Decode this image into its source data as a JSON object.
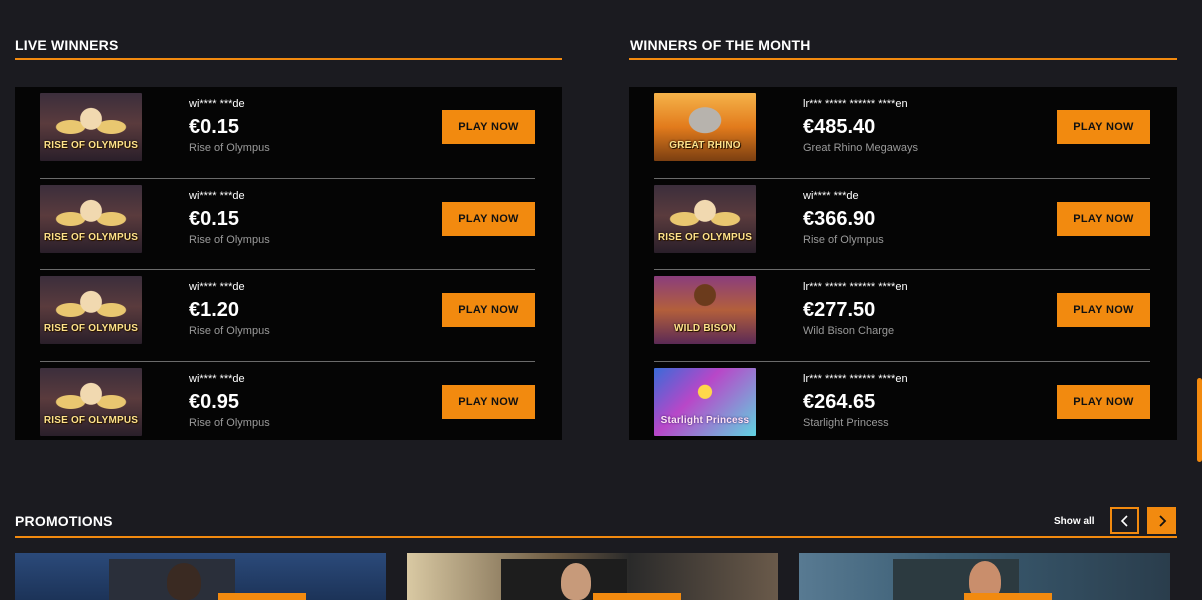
{
  "live_winners": {
    "title": "LIVE WINNERS",
    "rows": [
      {
        "user": "wi**** ***de",
        "amount": "€0.15",
        "game": "Rise of Olympus",
        "thumb_text": "RISE OF OLYMPUS",
        "button": "PLAY NOW"
      },
      {
        "user": "wi**** ***de",
        "amount": "€0.15",
        "game": "Rise of Olympus",
        "thumb_text": "RISE OF OLYMPUS",
        "button": "PLAY NOW"
      },
      {
        "user": "wi**** ***de",
        "amount": "€1.20",
        "game": "Rise of Olympus",
        "thumb_text": "RISE OF OLYMPUS",
        "button": "PLAY NOW"
      },
      {
        "user": "wi**** ***de",
        "amount": "€0.95",
        "game": "Rise of Olympus",
        "thumb_text": "RISE OF OLYMPUS",
        "button": "PLAY NOW"
      }
    ]
  },
  "winners_month": {
    "title": "WINNERS OF THE MONTH",
    "rows": [
      {
        "user": "lr*** ***** ****** ****en",
        "amount": "€485.40",
        "game": "Great Rhino Megaways",
        "thumb_text": "GREAT RHINO",
        "button": "PLAY NOW"
      },
      {
        "user": "wi**** ***de",
        "amount": "€366.90",
        "game": "Rise of Olympus",
        "thumb_text": "RISE OF OLYMPUS",
        "button": "PLAY NOW"
      },
      {
        "user": "lr*** ***** ****** ****en",
        "amount": "€277.50",
        "game": "Wild Bison Charge",
        "thumb_text": "WILD BISON",
        "button": "PLAY NOW"
      },
      {
        "user": "lr*** ***** ****** ****en",
        "amount": "€264.65",
        "game": "Starlight Princess",
        "thumb_text": "Starlight Princess",
        "button": "PLAY NOW"
      }
    ]
  },
  "promotions": {
    "title": "PROMOTIONS",
    "show_all": "Show all"
  },
  "icons": {
    "prev": "chevron-left-icon",
    "next": "chevron-right-icon"
  },
  "colors": {
    "accent": "#f28a0f",
    "background": "#1b1b20",
    "panel": "#050505"
  }
}
